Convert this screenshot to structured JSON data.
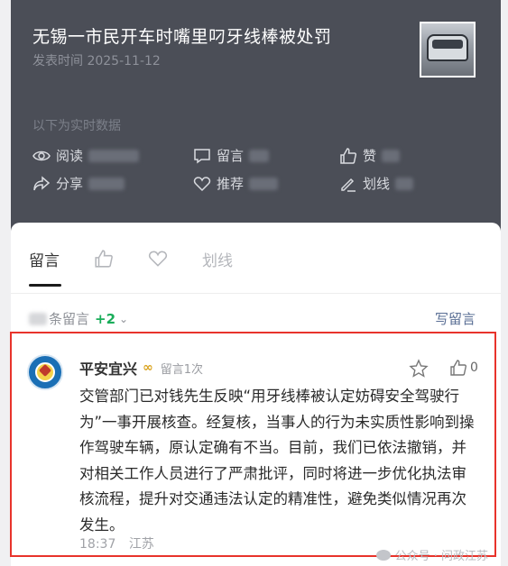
{
  "article": {
    "title": "无锡一市民开车时嘴里叼牙线棒被处罚",
    "date": "发表时间 2025-11-12",
    "thumbnail_icon": "car-photo-thumbnail"
  },
  "stats": {
    "realtime_label": "以下为实时数据",
    "read": "阅读",
    "comment": "留言",
    "like": "赞",
    "share": "分享",
    "recommend": "推荐",
    "highlight": "划线"
  },
  "tabs": {
    "comments": "留言",
    "highlight": "划线"
  },
  "comment_list": {
    "count_suffix": "条留言",
    "new_count": "+2",
    "write_label": "写留言"
  },
  "comment": {
    "author": "平安宜兴",
    "badge_text": "留言1次",
    "likes": "0",
    "body": "交管部门已对钱先生反映“用牙线棒被认定妨碍安全驾驶行为”一事开展核查。经复核，当事人的行为未实质性影响到操作驾驶车辆，原认定确有不当。目前，我们已依法撤销，并对相关工作人员进行了严肃批评，同时将进一步优化执法审核流程，提升对交通违法认定的精准性，避免类似情况再次发生。",
    "time": "18:37",
    "location": "江苏"
  },
  "watermark": "公众号 · 问政江苏",
  "colors": {
    "header_bg": "#4b4e57",
    "accent_green": "#1aad5a",
    "link_blue": "#5a6f95",
    "highlight_red": "#e8332b",
    "badge_gold": "#d9a21c"
  }
}
